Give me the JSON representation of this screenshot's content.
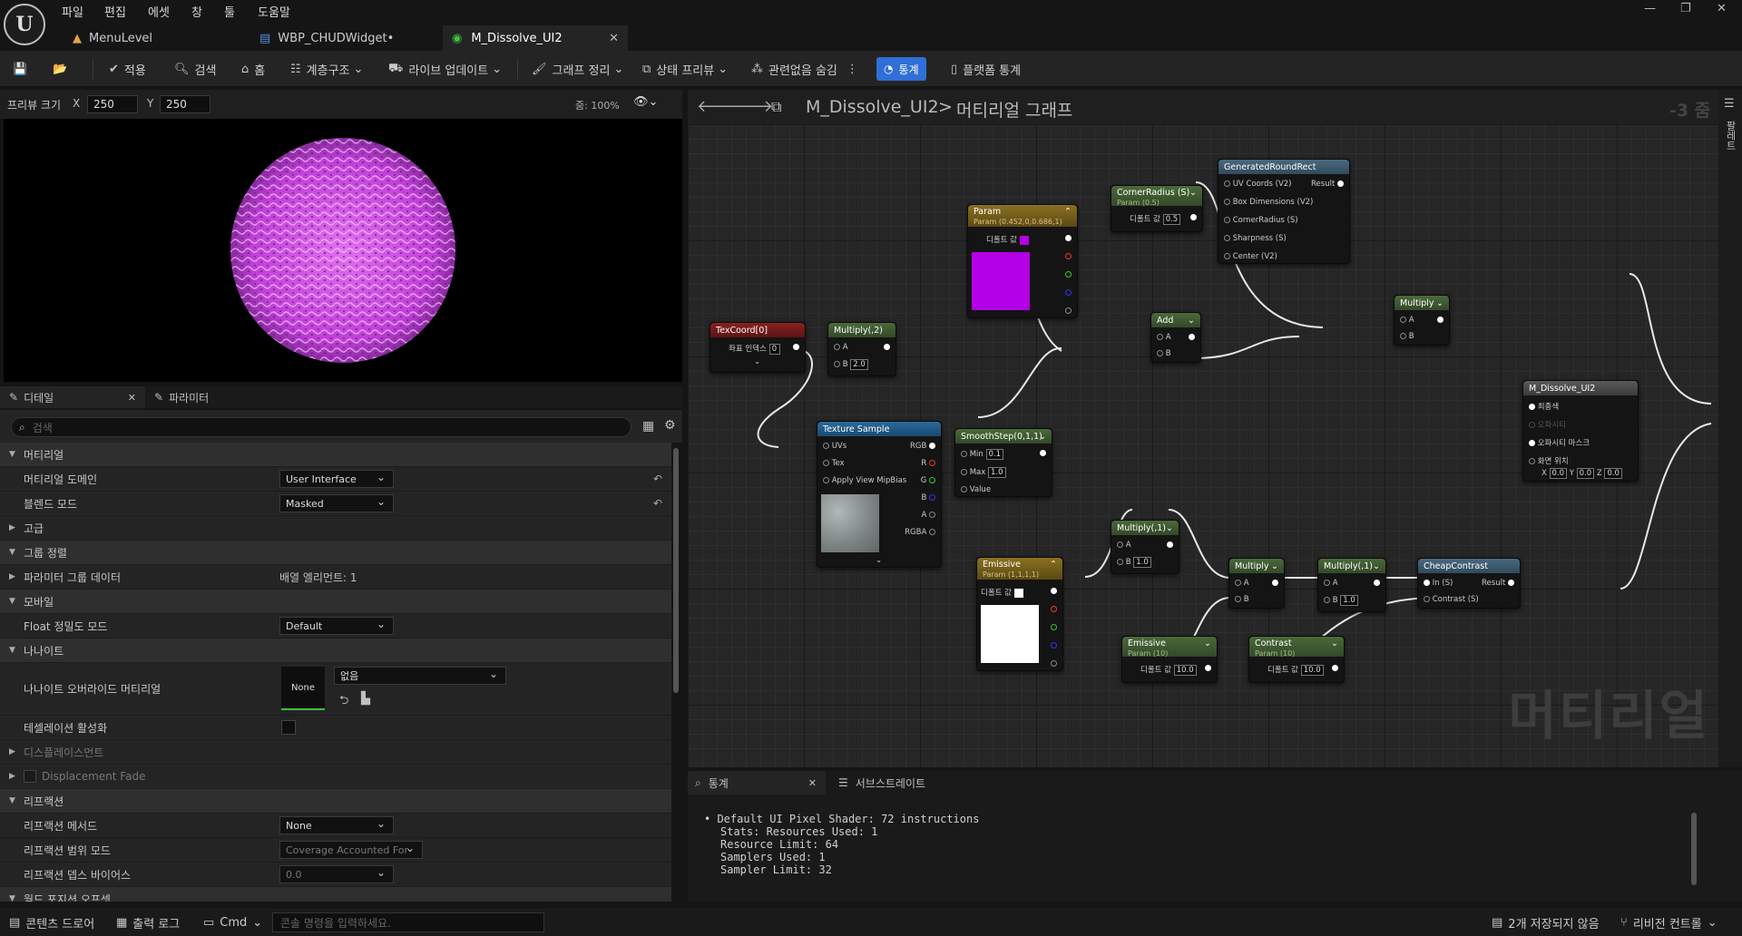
{
  "menu": [
    "파일",
    "편집",
    "에셋",
    "창",
    "툴",
    "도움말"
  ],
  "tabs": [
    {
      "label": "MenuLevel",
      "icon": "level-icon"
    },
    {
      "label": "WBP_CHUDWidget•",
      "icon": "widget-blueprint-icon"
    },
    {
      "label": "M_Dissolve_UI2",
      "icon": "material-icon"
    }
  ],
  "toolbar": {
    "apply": "적용",
    "search": "검색",
    "home": "홈",
    "hierarchy": "계층구조",
    "live_update": "라이브 업데이트",
    "clean_graph": "그래프 정리",
    "state_preview": "상태 프리뷰",
    "hide_unrelated": "관련없음 숨김",
    "stats": "통계",
    "platform_stats": "플랫폼 통계"
  },
  "preview": {
    "size_label": "프리뷰 크기",
    "x_label": "X",
    "x_value": "250",
    "y_label": "Y",
    "y_value": "250",
    "zoom": "줌: 100%"
  },
  "details": {
    "tab_details": "디테일",
    "tab_params": "파라미터",
    "search_placeholder": "검색",
    "rows": {
      "material": "머티리얼",
      "material_domain": "머티리얼 도메인",
      "material_domain_value": "User Interface",
      "blend_mode": "블렌드 모드",
      "blend_mode_value": "Masked",
      "advanced": "고급",
      "group_sort": "그룹 정렬",
      "param_group_data": "파라미터 그룹 데이터",
      "param_group_value": "배열 엘리먼트: 1",
      "mobile": "모바일",
      "float_precision": "Float 정밀도 모드",
      "float_precision_value": "Default",
      "nanite": "나나이트",
      "nanite_override": "나나이트 오버라이드 머티리얼",
      "nanite_none": "None",
      "nanite_dropdown": "없음",
      "tessellation": "테셀레이션 활성화",
      "displacement": "디스플레이스먼트",
      "displacement_fade": "Displacement Fade",
      "refraction": "리프랙션",
      "refraction_method": "리프랙션 메서드",
      "refraction_method_value": "None",
      "refraction_coverage": "리프랙션 범위 모드",
      "refraction_coverage_value": "Coverage Accounted For",
      "refraction_depth": "리프랙션 뎁스 바이어스",
      "refraction_depth_value": "0.0",
      "world_position": "월드 포지션 오프셋"
    }
  },
  "graph": {
    "breadcrumb_asset": "M_Dissolve_UI2",
    "breadcrumb_sep": ">",
    "breadcrumb_graph": "머티리얼 그래프",
    "zoom": "-3 줌",
    "watermark": "머티리얼",
    "side_tab": "팔레트"
  },
  "nodes": {
    "texcoord": {
      "title": "TexCoord[0]",
      "pin": "좌표 인덱스",
      "value": "0"
    },
    "multiply2": {
      "title": "Multiply(,2)",
      "a": "A",
      "b": "B",
      "b_value": "2.0"
    },
    "texsample": {
      "title": "Texture Sample",
      "uvs": "UVs",
      "tex": "Tex",
      "mip": "Apply View MipBias",
      "rgb": "RGB",
      "r": "R",
      "g": "G",
      "b": "B",
      "a": "A",
      "rgba": "RGBA"
    },
    "param": {
      "title": "Param",
      "sub": "Param (0.452,0,0.686,1)",
      "default": "디폴트 값"
    },
    "corner": {
      "title": "CornerRadius (S)",
      "sub": "Param (0.5)",
      "default": "디폴트 값",
      "value": "0.5"
    },
    "roundrect": {
      "title": "GeneratedRoundRect",
      "uv": "UV Coords (V2)",
      "result": "Result",
      "box": "Box Dimensions (V2)",
      "cr": "CornerRadius (S)",
      "sharp": "Sharpness (S)",
      "center": "Center (V2)"
    },
    "add": {
      "title": "Add",
      "a": "A",
      "b": "B"
    },
    "smooth": {
      "title": "SmoothStep(0,1,1)",
      "min": "Min",
      "min_value": "0.1",
      "max": "Max",
      "max_value": "1.0",
      "value": "Value"
    },
    "mult_top": {
      "title": "Multiply",
      "a": "A",
      "b": "B"
    },
    "output": {
      "title": "M_Dissolve_UI2",
      "final": "최종색",
      "opacity": "오파시티",
      "opacity_mask": "오파시티 마스크",
      "screen_pos": "화면 위치",
      "x": "0.0",
      "y": "0.0",
      "z": "0.0"
    },
    "emissive1": {
      "title": "Emissive",
      "sub": "Param (1,1,1,1)",
      "default": "디폴트 값"
    },
    "mult1": {
      "title": "Multiply(,1)",
      "a": "A",
      "b": "B",
      "b_value": "1.0"
    },
    "mult_mid": {
      "title": "Multiply",
      "a": "A",
      "b": "B"
    },
    "mult1b": {
      "title": "Multiply(,1)",
      "a": "A",
      "b": "B",
      "b_value": "1.0"
    },
    "cheap": {
      "title": "CheapContrast",
      "in": "In (S)",
      "result": "Result",
      "contrast": "Contrast (S)"
    },
    "emissive2": {
      "title": "Emissive",
      "sub": "Param (10)",
      "default": "디폴트 값",
      "value": "10.0"
    },
    "contrast": {
      "title": "Contrast",
      "sub": "Param (10)",
      "default": "디폴트 값",
      "value": "10.0"
    }
  },
  "stats": {
    "tab_stats": "통계",
    "tab_substrate": "서브스트레이트",
    "lines": [
      "Default UI Pixel Shader: 72 instructions",
      "Stats: Resources Used: 1",
      "Resource Limit: 64",
      "Samplers Used: 1",
      "Sampler Limit: 32"
    ]
  },
  "status": {
    "content_drawer": "콘텐츠 드로어",
    "output_log": "출력 로그",
    "cmd": "Cmd",
    "console_placeholder": "콘솔 명령을 입력하세요.",
    "unsaved": "2개 저장되지 않음",
    "revision": "리비전 컨트롤"
  },
  "colors": {
    "accent": "#2f6fd6",
    "param_color": "#b300e6",
    "preview_sphere": "#c040d8"
  }
}
